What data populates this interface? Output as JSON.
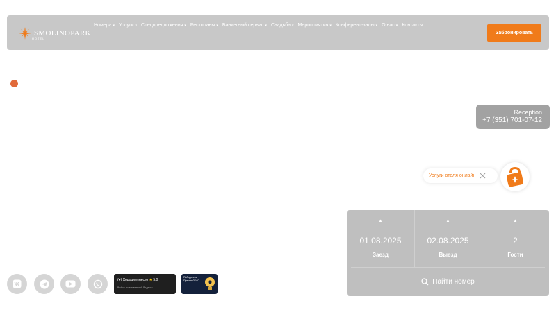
{
  "header": {
    "logo_text": "SMOLINOPARK",
    "logo_sub": "HOTEL",
    "menu": [
      {
        "label": "Номера",
        "dropdown": true
      },
      {
        "label": "Услуги",
        "dropdown": true
      },
      {
        "label": "Спецпредложения",
        "dropdown": true
      },
      {
        "label": "Рестораны",
        "dropdown": true
      },
      {
        "label": "Банкетный сервис",
        "dropdown": true
      },
      {
        "label": "Свадьба",
        "dropdown": true
      },
      {
        "label": "Мероприятия",
        "dropdown": true
      },
      {
        "label": "Конференц-залы",
        "dropdown": true
      },
      {
        "label": "О нас",
        "dropdown": true
      },
      {
        "label": "Контакты",
        "dropdown": false
      }
    ],
    "book_label": "Забронировать"
  },
  "reception": {
    "title": "Reception",
    "phone": "+7 (351) 701-07-12"
  },
  "services": {
    "label": "Услуги отеля онлайн"
  },
  "booking": {
    "checkin_value": "01.08.2025",
    "checkin_label": "Заезд",
    "checkout_value": "02.08.2025",
    "checkout_label": "Выезд",
    "guests_value": "2",
    "guests_label": "Гости",
    "search_label": "Найти номер"
  },
  "social": [
    "vk-icon",
    "telegram-icon",
    "youtube-icon",
    "whatsapp-icon"
  ],
  "badges": {
    "yandex_title": "Хорошее место",
    "yandex_rating": "5,0",
    "yandex_sub": "Выбор пользователей Яндекса",
    "twogis_title": "Победитель Премии 2ГИС"
  },
  "colors": {
    "accent": "#f07b1a",
    "navbar": "#c8c8c8",
    "booking_panel": "#bfbfbf",
    "reception_box": "#a2a2a2",
    "dot": "#e16a3a"
  }
}
